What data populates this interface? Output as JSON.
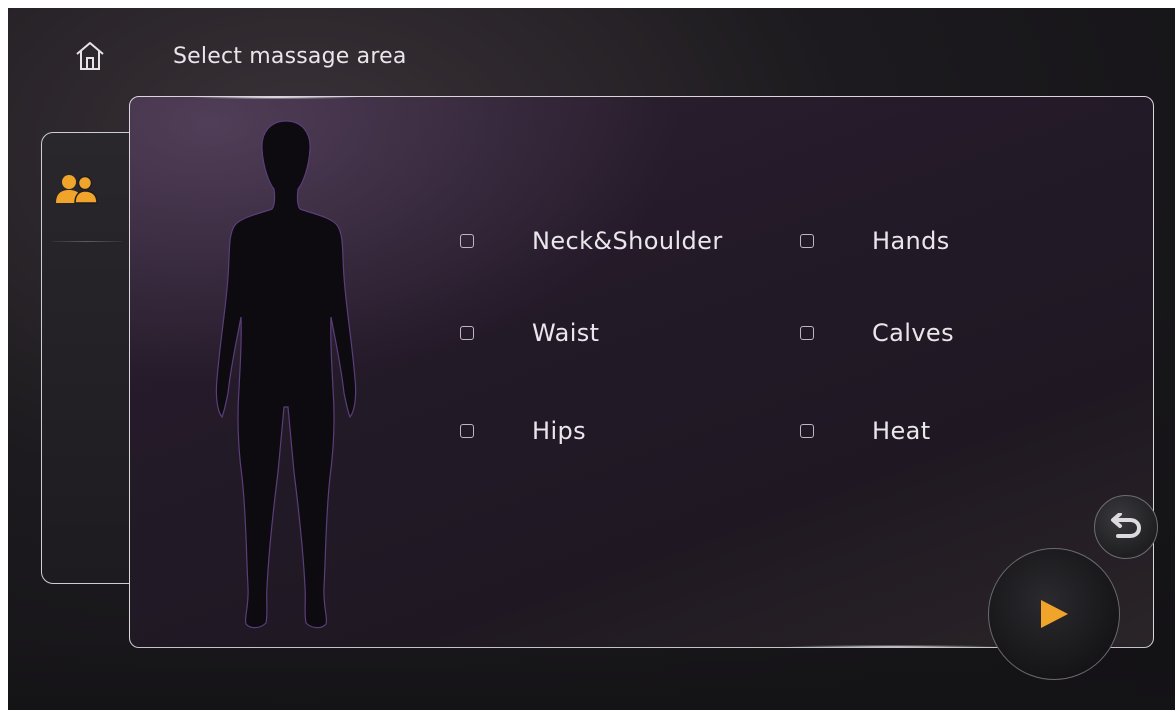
{
  "header": {
    "home_icon": "home-icon",
    "title": "Select massage area"
  },
  "sidebar": {
    "users_icon": "users-icon",
    "accent_color": "#f0a52a"
  },
  "options": [
    {
      "label": "Neck&Shoulder",
      "checked": false
    },
    {
      "label": "Hands",
      "checked": false
    },
    {
      "label": "Waist",
      "checked": false
    },
    {
      "label": "Calves",
      "checked": false
    },
    {
      "label": "Hips",
      "checked": false
    },
    {
      "label": "Heat",
      "checked": false
    }
  ],
  "controls": {
    "back_icon": "return-arrow-icon",
    "play_icon": "play-icon",
    "play_color": "#f0a52a"
  }
}
